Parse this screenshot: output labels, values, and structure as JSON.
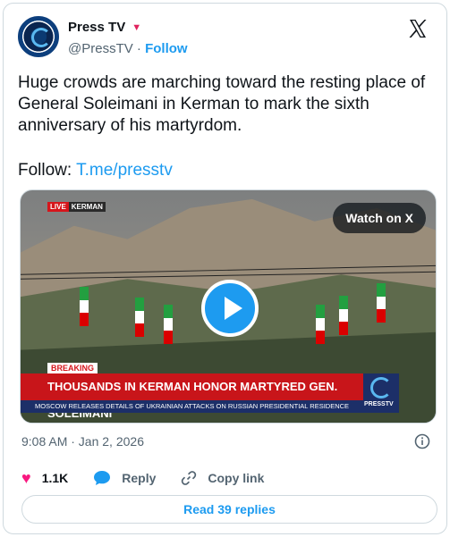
{
  "account": {
    "name": "Press TV",
    "handle": "@PressTV",
    "separator": "·",
    "follow_label": "Follow",
    "badge_color": "#e0245e"
  },
  "tweet": {
    "text": "Huge crowds are marching toward the resting place of General Soleimani in Kerman to mark the sixth anniversary of his martyrdom.",
    "follow_prefix": "Follow:",
    "follow_link": "T.me/presstv",
    "timestamp": "9:08 AM · Jan 2, 2026"
  },
  "media": {
    "watch_label": "Watch on X",
    "live_tag": "LIVE",
    "location_tag": "KERMAN",
    "breaking_label": "BREAKING",
    "headline": "THOUSANDS IN KERMAN HONOR MARTYRED GEN. SOLEIMANI",
    "ticker": "MOSCOW RELEASES DETAILS OF UKRAINIAN ATTACKS ON RUSSIAN PRESIDENTIAL RESIDENCE",
    "channel_logo_text": "PRESSTV"
  },
  "actions": {
    "likes": "1.1K",
    "reply_label": "Reply",
    "copy_label": "Copy link"
  },
  "footer": {
    "read_replies_label": "Read 39 replies"
  },
  "icons": [
    "x-logo-icon",
    "verified-icon",
    "play-icon",
    "info-icon",
    "heart-icon",
    "reply-icon",
    "link-icon"
  ]
}
